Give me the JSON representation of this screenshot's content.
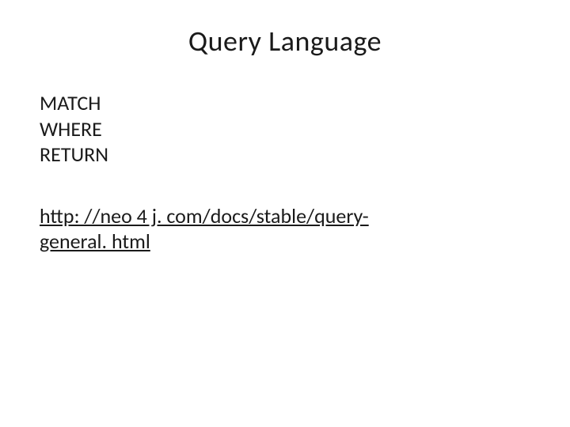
{
  "slide": {
    "title": "Query Language",
    "keywords": {
      "line1": "MATCH",
      "line2": "WHERE",
      "line3": "RETURN"
    },
    "link": {
      "line1": "http: //neo 4 j. com/docs/stable/query-",
      "line2": "general. html"
    }
  }
}
